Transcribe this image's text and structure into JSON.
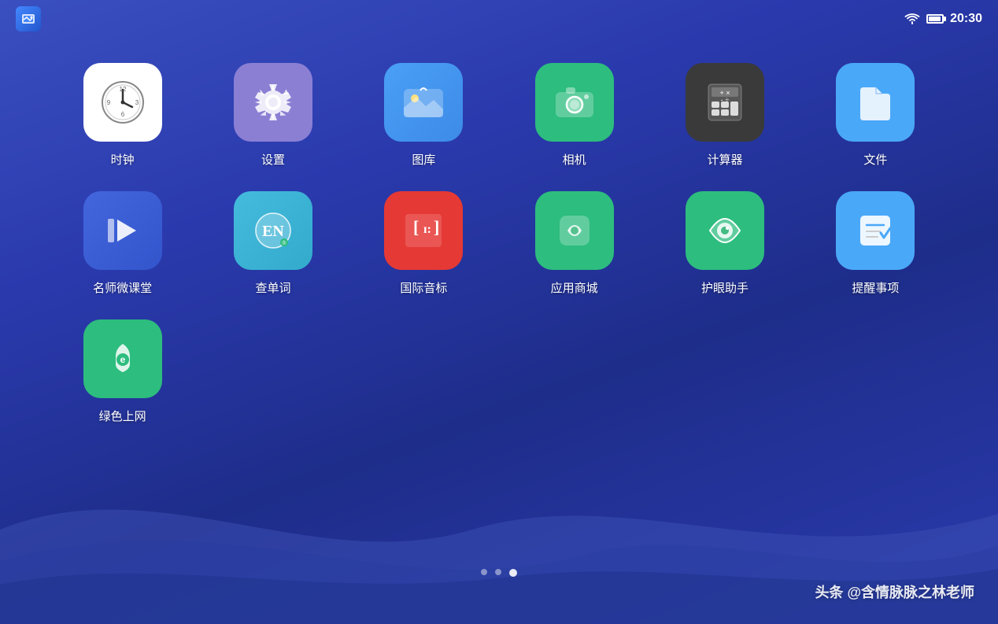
{
  "statusBar": {
    "time": "20:30"
  },
  "apps": [
    {
      "id": "clock",
      "label": "时钟",
      "iconClass": "icon-clock"
    },
    {
      "id": "settings",
      "label": "设置",
      "iconClass": "icon-settings"
    },
    {
      "id": "gallery",
      "label": "图库",
      "iconClass": "icon-gallery"
    },
    {
      "id": "camera",
      "label": "相机",
      "iconClass": "icon-camera"
    },
    {
      "id": "calculator",
      "label": "计算器",
      "iconClass": "icon-calculator"
    },
    {
      "id": "files",
      "label": "文件",
      "iconClass": "icon-files"
    },
    {
      "id": "mingshi",
      "label": "名师微课堂",
      "iconClass": "icon-mingshi"
    },
    {
      "id": "dictionary",
      "label": "查单词",
      "iconClass": "icon-dictionary"
    },
    {
      "id": "phonetic",
      "label": "国际音标",
      "iconClass": "icon-phonetic"
    },
    {
      "id": "appstore",
      "label": "应用商城",
      "iconClass": "icon-appstore"
    },
    {
      "id": "eyecare",
      "label": "护眼助手",
      "iconClass": "icon-eyecare"
    },
    {
      "id": "reminder",
      "label": "提醒事项",
      "iconClass": "icon-reminder"
    },
    {
      "id": "green",
      "label": "绿色上网",
      "iconClass": "icon-green"
    }
  ],
  "dots": [
    {
      "active": false
    },
    {
      "active": false
    },
    {
      "active": true
    }
  ],
  "watermark": "头条 @含情脉脉之林老师"
}
